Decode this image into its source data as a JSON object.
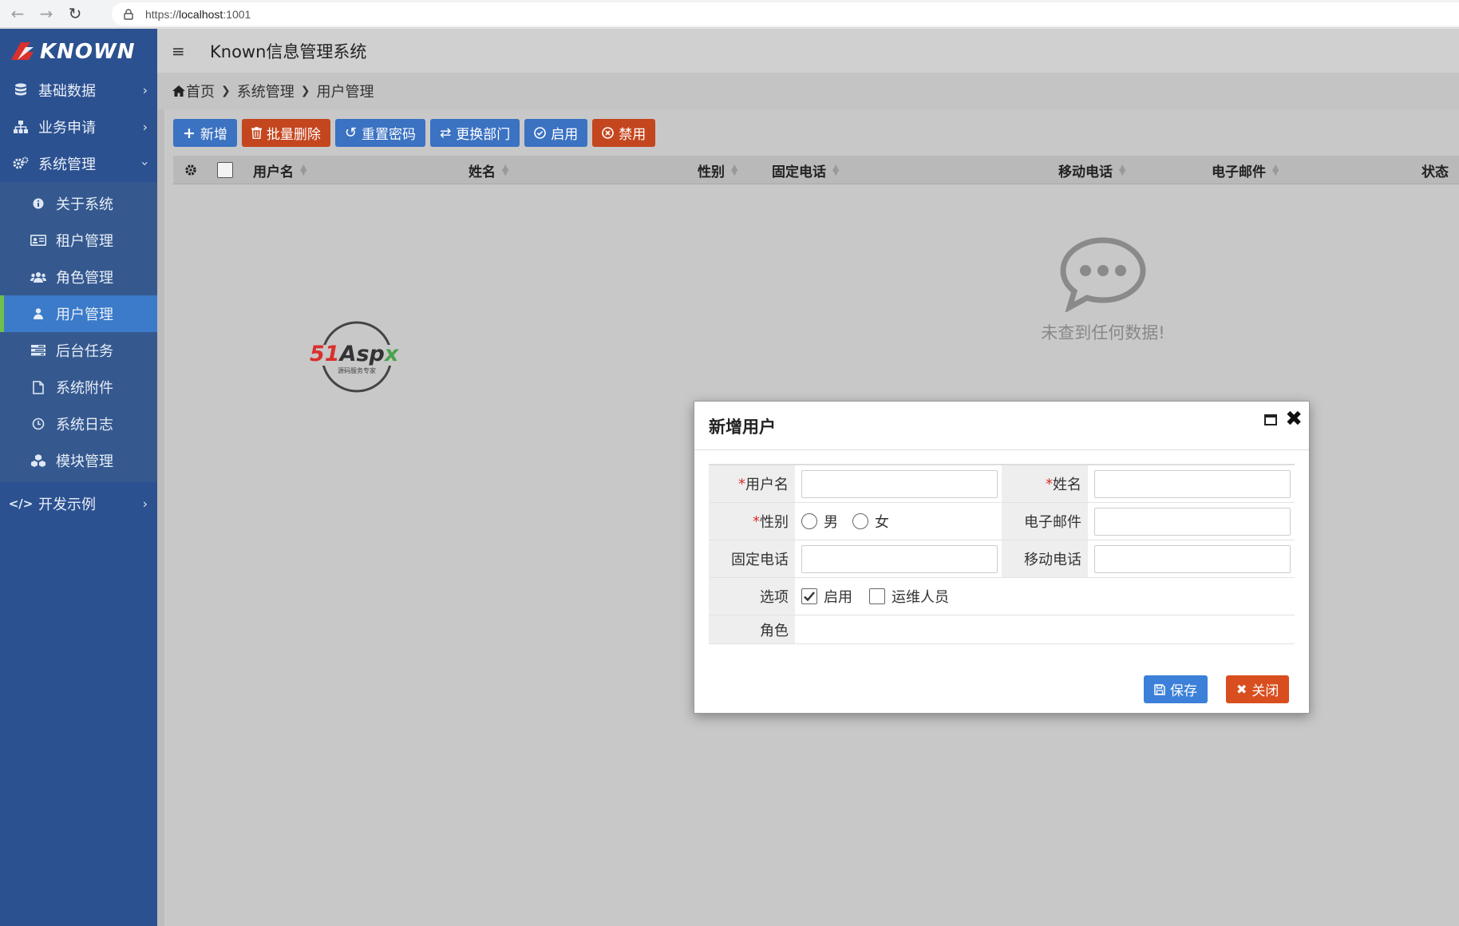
{
  "browser": {
    "url_prefix": "https://",
    "url_host": "localhost",
    "url_port": ":1001"
  },
  "sidebar": {
    "brand": "KNOWN",
    "menu": [
      {
        "label": "基础数据",
        "icon": "database-icon"
      },
      {
        "label": "业务申请",
        "icon": "sitemap-icon"
      },
      {
        "label": "系统管理",
        "icon": "gears-icon"
      }
    ],
    "submenu": [
      {
        "label": "关于系统",
        "icon": "info-icon"
      },
      {
        "label": "租户管理",
        "icon": "id-card-icon"
      },
      {
        "label": "角色管理",
        "icon": "users-icon"
      },
      {
        "label": "用户管理",
        "icon": "user-icon"
      },
      {
        "label": "后台任务",
        "icon": "tasks-icon"
      },
      {
        "label": "系统附件",
        "icon": "file-icon"
      },
      {
        "label": "系统日志",
        "icon": "clock-icon"
      },
      {
        "label": "模块管理",
        "icon": "cubes-icon"
      }
    ],
    "dev": {
      "label": "开发示例",
      "icon": "code-icon"
    }
  },
  "header": {
    "title": "Known信息管理系统"
  },
  "breadcrumb": {
    "home": "首页",
    "level1": "系统管理",
    "level2": "用户管理"
  },
  "toolbar": {
    "add": "新增",
    "batch_delete": "批量删除",
    "reset_password": "重置密码",
    "change_dept": "更换部门",
    "enable": "启用",
    "disable": "禁用"
  },
  "grid": {
    "columns": [
      "用户名",
      "姓名",
      "性别",
      "固定电话",
      "移动电话",
      "电子邮件",
      "状态"
    ],
    "empty_text": "未查到任何数据!"
  },
  "watermark": {
    "brand": "51Aspx",
    "tagline": "源码服务专家"
  },
  "dialog": {
    "title": "新增用户",
    "fields": {
      "username": "用户名",
      "name": "姓名",
      "gender": "性别",
      "male": "男",
      "female": "女",
      "email": "电子邮件",
      "phone": "固定电话",
      "mobile": "移动电话",
      "options": "选项",
      "enabled": "启用",
      "ops_staff": "运维人员",
      "role": "角色"
    },
    "required_mark": "*",
    "save": "保存",
    "close": "关闭"
  },
  "colors": {
    "sidebar": "#2c5190",
    "active_item": "#3b7bc9",
    "primary": "#3b72c2",
    "danger": "#c4461e"
  }
}
